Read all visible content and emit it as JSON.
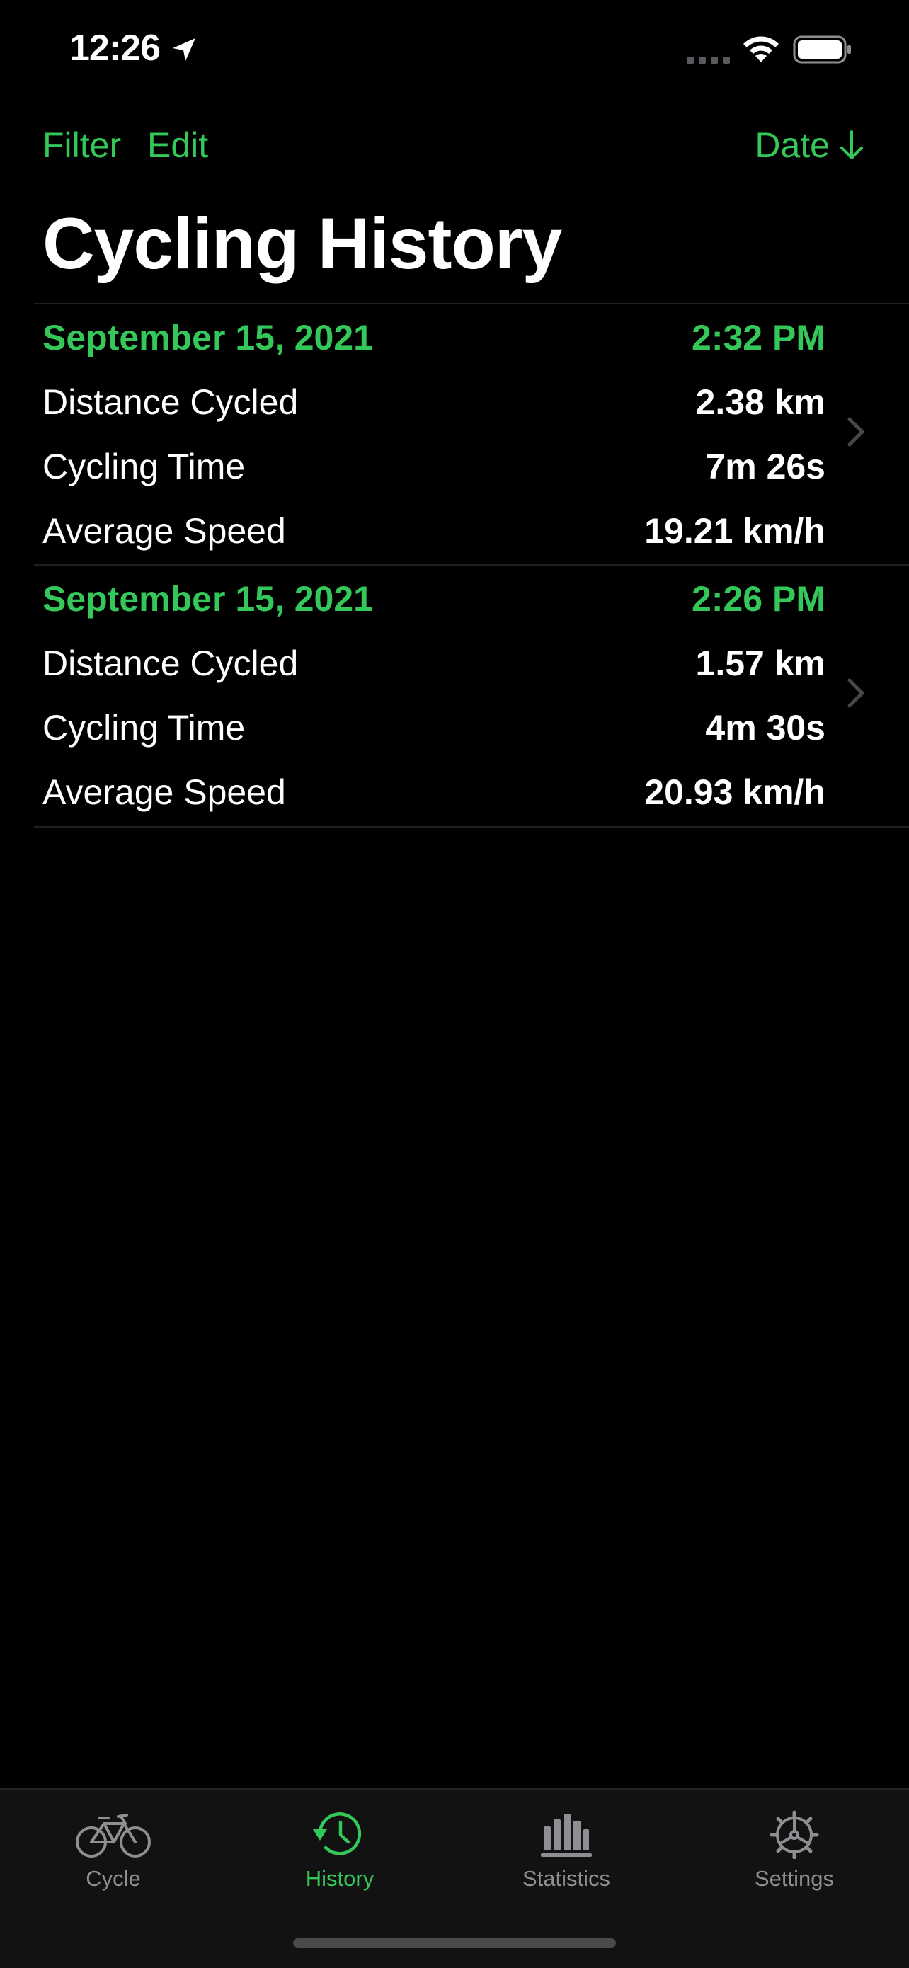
{
  "status_bar": {
    "time": "12:26"
  },
  "nav": {
    "filter_label": "Filter",
    "edit_label": "Edit",
    "sort_label": "Date"
  },
  "title": "Cycling History",
  "entries": [
    {
      "date": "September 15, 2021",
      "time": "2:32 PM",
      "distance_label": "Distance Cycled",
      "distance_value": "2.38 km",
      "cycling_time_label": "Cycling Time",
      "cycling_time_value": "7m 26s",
      "avg_speed_label": "Average Speed",
      "avg_speed_value": "19.21 km/h"
    },
    {
      "date": "September 15, 2021",
      "time": "2:26 PM",
      "distance_label": "Distance Cycled",
      "distance_value": "1.57 km",
      "cycling_time_label": "Cycling Time",
      "cycling_time_value": "4m 30s",
      "avg_speed_label": "Average Speed",
      "avg_speed_value": "20.93 km/h"
    }
  ],
  "tab_bar": {
    "tabs": [
      {
        "label": "Cycle",
        "icon": "bicycle-icon"
      },
      {
        "label": "History",
        "icon": "history-icon"
      },
      {
        "label": "Statistics",
        "icon": "bar-chart-icon"
      },
      {
        "label": "Settings",
        "icon": "gear-icon"
      }
    ],
    "active_tab": "History"
  },
  "colors": {
    "accent": "#34c759",
    "background": "#000000",
    "tab_bar_background": "#121212",
    "inactive": "#8e8e93"
  }
}
